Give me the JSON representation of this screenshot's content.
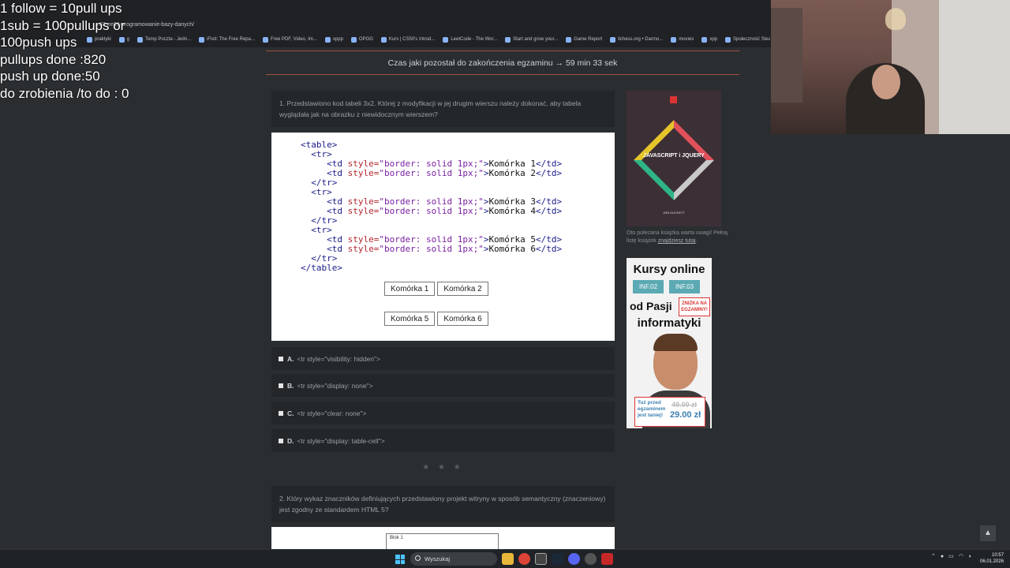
{
  "overlay": {
    "lines": [
      "1 follow = 10pull ups",
      "1sub = 100pullups or",
      "100push ups",
      "pullups done :820",
      "push up done:50",
      "do zrobienia /to do : 0"
    ]
  },
  "browser": {
    "url": "...03-ee09-programowanie-bazy-danych/",
    "bookmarks": [
      {
        "label": "praktyki",
        "icon": "folder-icon"
      },
      {
        "label": "g",
        "icon": "folder-icon"
      },
      {
        "label": "Temp Poczta - Jedn...",
        "icon": "mail-icon"
      },
      {
        "label": "iFixit: The Free Repa...",
        "icon": "wrench-icon"
      },
      {
        "label": "Free PDF, Video, Im...",
        "icon": "shield-icon"
      },
      {
        "label": "xppp",
        "icon": "folder-icon"
      },
      {
        "label": "OPGG",
        "icon": "game-icon"
      },
      {
        "label": "Kurs | CS50's Introd...",
        "icon": "x-icon"
      },
      {
        "label": "LeetCode - The Wor...",
        "icon": "code-icon"
      },
      {
        "label": "Start and grow your...",
        "icon": "shop-icon"
      },
      {
        "label": "Game Report",
        "icon": "report-icon"
      },
      {
        "label": "lichess.org • Darmo...",
        "icon": "chess-icon"
      },
      {
        "label": "movies",
        "icon": "folder-icon"
      },
      {
        "label": "xpp",
        "icon": "folder-icon"
      },
      {
        "label": "Społeczność Steam...",
        "icon": "steam-icon"
      }
    ]
  },
  "exam": {
    "timer_text": "Czas jaki pozostał do zakończenia egzaminu → 59 min 33 sek",
    "q1_text": "1. Przedstawiono kod tabeli 3x2. Której z modyfikacji w jej drugim wierszu należy dokonać, aby tabela wyglądała jak na obrazku z niewidocznym wierszem?",
    "code_lines": [
      "<table>",
      "  <tr>",
      "     <td style=\"border: solid 1px;\">Komórka 1</td>",
      "     <td style=\"border: solid 1px;\">Komórka 2</td>",
      "  </tr>",
      "  <tr>",
      "     <td style=\"border: solid 1px;\">Komórka 3</td>",
      "     <td style=\"border: solid 1px;\">Komórka 4</td>",
      "  </tr>",
      "  <tr>",
      "     <td style=\"border: solid 1px;\">Komórka 5</td>",
      "     <td style=\"border: solid 1px;\">Komórka 6</td>",
      "  </tr>",
      "</table>"
    ],
    "preview_cells": {
      "row1": [
        "Komórka 1",
        "Komórka 2"
      ],
      "row2": [
        "Komórka 5",
        "Komórka 6"
      ]
    },
    "answers": [
      {
        "letter": "A.",
        "text": "<tr style=\"visibility: hidden\">"
      },
      {
        "letter": "B.",
        "text": "<tr style=\"display: none\">"
      },
      {
        "letter": "C.",
        "text": "<tr style=\"clear: none\">"
      },
      {
        "letter": "D.",
        "text": "<tr style=\"display: table-cell\">"
      }
    ],
    "separator": "★ ★ ★",
    "q2_text": "2. Który wykaz znaczników definiujących przedstawiony projekt witryny w sposób semantyczny (znaczeniowy) jest zgodny ze standardem HTML 5?",
    "q2_diagram_label": "Blok 1"
  },
  "sidebar": {
    "book_title": "JAVASCRIPT i JQUERY",
    "book_author": "JON DUCKETT",
    "book_note_prefix": "Oto polecana książka warta uwagi! Pełną listę książek ",
    "book_note_link": "znajdziesz tutaj",
    "book_note_suffix": ".",
    "ad_title": "Kursy online",
    "ad_tag1": "INF.02",
    "ad_tag2": "INF.03",
    "ad_line2": "od Pasji",
    "ad_promo": "ZNIŻKA NA EGZAMINY!",
    "ad_line3": "informatyki",
    "ad_price_text": "Tuż przed egzaminem jest taniej!",
    "ad_old_price": "49.00 zł",
    "ad_new_price": "29.00 zł"
  },
  "taskbar": {
    "search_label": "Wyszukaj",
    "time": "10:57",
    "date": "06.01.2026"
  }
}
